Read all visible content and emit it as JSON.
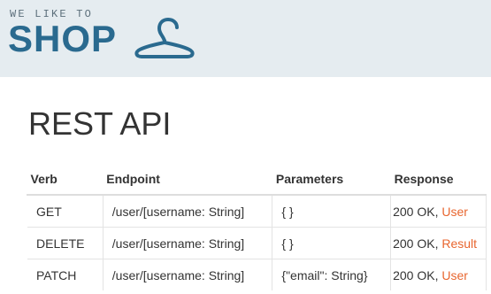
{
  "header": {
    "tagline": "WE LIKE TO",
    "brand": "SHOP",
    "logo_icon": "hanger-icon",
    "background": "#e5ecf0",
    "brand_color": "#2a6a8f"
  },
  "page": {
    "title": "REST API"
  },
  "table": {
    "headers": [
      "Verb",
      "Endpoint",
      "Parameters",
      "Response"
    ],
    "rows": [
      {
        "verb": "GET",
        "endpoint": "/user/[username: String]",
        "parameters": "{ }",
        "status": "200 OK, ",
        "type": "User"
      },
      {
        "verb": "DELETE",
        "endpoint": "/user/[username: String]",
        "parameters": "{ }",
        "status": "200 OK, ",
        "type": "Result"
      },
      {
        "verb": "PATCH",
        "endpoint": "/user/[username: String]",
        "parameters": "{\"email\": String}",
        "status": "200 OK, ",
        "type": "User"
      }
    ],
    "link_color": "#e8662f"
  }
}
